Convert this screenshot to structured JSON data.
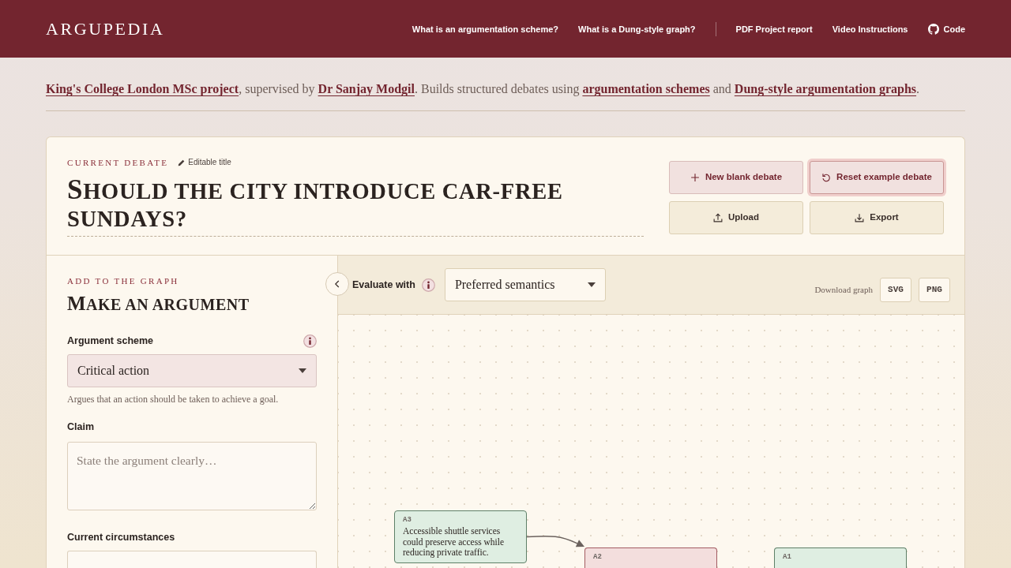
{
  "header": {
    "logo": "ARGUPEDIA",
    "nav_groups": [
      [
        {
          "label": "What is an argumentation scheme?",
          "kind": "text"
        },
        {
          "label": "What is a Dung-style graph?",
          "kind": "text"
        }
      ],
      [
        {
          "label": "PDF Project report",
          "kind": "text"
        },
        {
          "label": "Video Instructions",
          "kind": "text"
        },
        {
          "label": "Code",
          "kind": "repo"
        }
      ]
    ]
  },
  "intro": {
    "segments": [
      {
        "text": "King's College London MSc project",
        "link": true
      },
      {
        "text": ", supervised by ",
        "link": false
      },
      {
        "text": "Dr Sanjay Modgil",
        "link": true
      },
      {
        "text": ". Builds structured debates using ",
        "link": false
      },
      {
        "text": "argumentation schemes",
        "link": true
      },
      {
        "text": " and ",
        "link": false
      },
      {
        "text": "Dung-style argumentation graphs",
        "link": true
      },
      {
        "text": ".",
        "link": false
      }
    ]
  },
  "debate": {
    "label": "CURRENT DEBATE",
    "edit_hint": "Editable title",
    "title": "SHOULD THE CITY INTRODUCE CAR-FREE SUNDAYS?",
    "actions": [
      {
        "label": "New blank debate",
        "kind": "new",
        "primary": true,
        "focused": false
      },
      {
        "label": "Reset example debate",
        "kind": "reset",
        "primary": true,
        "focused": true
      },
      {
        "label": "Upload",
        "kind": "upload",
        "primary": false,
        "focused": false
      },
      {
        "label": "Export",
        "kind": "export",
        "primary": false,
        "focused": false
      }
    ]
  },
  "form": {
    "label": "ADD TO THE GRAPH",
    "title": "MAKE AN ARGUMENT",
    "fields": [
      {
        "kind": "select",
        "label": "Argument scheme",
        "info": true,
        "value": "Critical action",
        "help": "Argues that an action should be taken to achieve a goal."
      },
      {
        "kind": "textarea",
        "label": "Claim",
        "info": false,
        "placeholder": "State the argument clearly…"
      },
      {
        "kind": "textarea",
        "label": "Current circumstances",
        "info": false
      }
    ]
  },
  "graph": {
    "evaluate_label": "Evaluate with",
    "semantics": "Preferred semantics",
    "download_label": "Download graph",
    "download_formats": [
      "SVG",
      "PNG"
    ],
    "nodes": [
      {
        "id": "A3",
        "accepted": true,
        "attacks_next": true,
        "text": "Accessible shuttle services could preserve access while reducing private traffic."
      },
      {
        "id": "A2",
        "accepted": false,
        "attacks_next": false
      },
      {
        "id": "A1",
        "accepted": true,
        "attacks_next": false
      }
    ]
  }
}
